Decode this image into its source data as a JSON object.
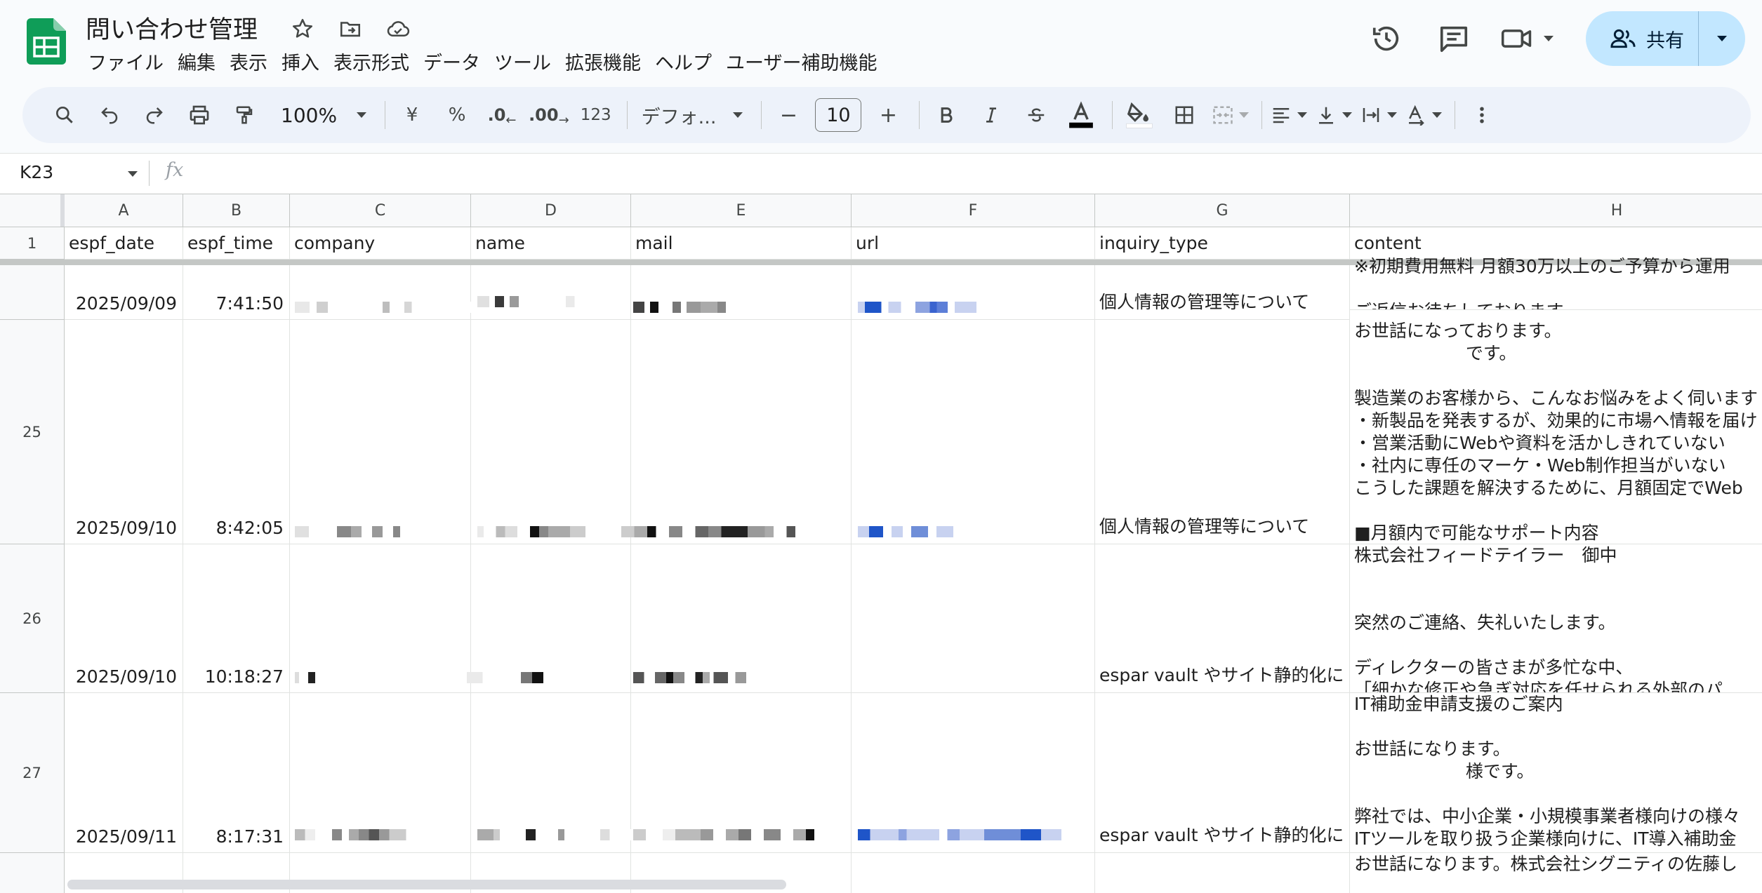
{
  "app": {
    "doc_title": "問い合わせ管理",
    "menu": [
      "ファイル",
      "編集",
      "表示",
      "挿入",
      "表示形式",
      "データ",
      "ツール",
      "拡張機能",
      "ヘルプ",
      "ユーザー補助機能"
    ],
    "share_label": "共有"
  },
  "toolbar": {
    "zoom": "100%",
    "currency": "¥",
    "percent": "%",
    "dec_decrease": ".0",
    "dec_increase": ".00",
    "number_format": "123",
    "font": "デフォ...",
    "font_size": "10",
    "minus": "−",
    "plus": "+"
  },
  "formula_bar": {
    "cell_ref": "K23",
    "fx": "fx",
    "value": ""
  },
  "columns": [
    "A",
    "B",
    "C",
    "D",
    "E",
    "F",
    "G",
    "H"
  ],
  "header_row": {
    "number": "1",
    "cells": [
      "espf_date",
      "espf_time",
      "company",
      "name",
      "mail",
      "url",
      "inquiry_type",
      "content"
    ]
  },
  "rows": [
    {
      "number": "",
      "date": "2025/09/09",
      "time": "7:41:50",
      "inquiry_type": "個人情報の管理等について",
      "content": "※初期費用無料 月額30万以上のご予算から運用\n\nご返信お待ちしております。"
    },
    {
      "number": "25",
      "date": "2025/09/10",
      "time": "8:42:05",
      "inquiry_type": "個人情報の管理等について",
      "content": "お世話になっております。\n                    です。\n\n製造業のお客様から、こんなお悩みをよく伺います\n・新製品を発表するが、効果的に市場へ情報を届け\n・営業活動にWebや資料を活かしきれていない\n・社内に専任のマーケ・Web制作担当がいない\nこうした課題を解決するために、月額固定でWeb\n\n■月額内で可能なサポート内容"
    },
    {
      "number": "26",
      "date": "2025/09/10",
      "time": "10:18:27",
      "inquiry_type": "espar vault やサイト静的化に",
      "content": "株式会社フィードテイラー　御中\n\n\n突然のご連絡、失礼いたします。\n\nディレクターの皆さまが多忙な中、\n「細かな修正や急ぎ対応を任せられる外部のパ"
    },
    {
      "number": "27",
      "date": "2025/09/11",
      "time": "8:17:31",
      "inquiry_type": "espar vault やサイト静的化に",
      "content": "IT補助金申請支援のご案内\n\nお世話になります。\n                    様です。\n\n弊社では、中小企業・小規模事業者様向けの様々\nITツールを取り扱う企業様向けに、IT導入補助金"
    },
    {
      "number": "",
      "date": "",
      "time": "",
      "inquiry_type": "",
      "content": "お世話になります。株式会社シグニティの佐藤し"
    }
  ]
}
